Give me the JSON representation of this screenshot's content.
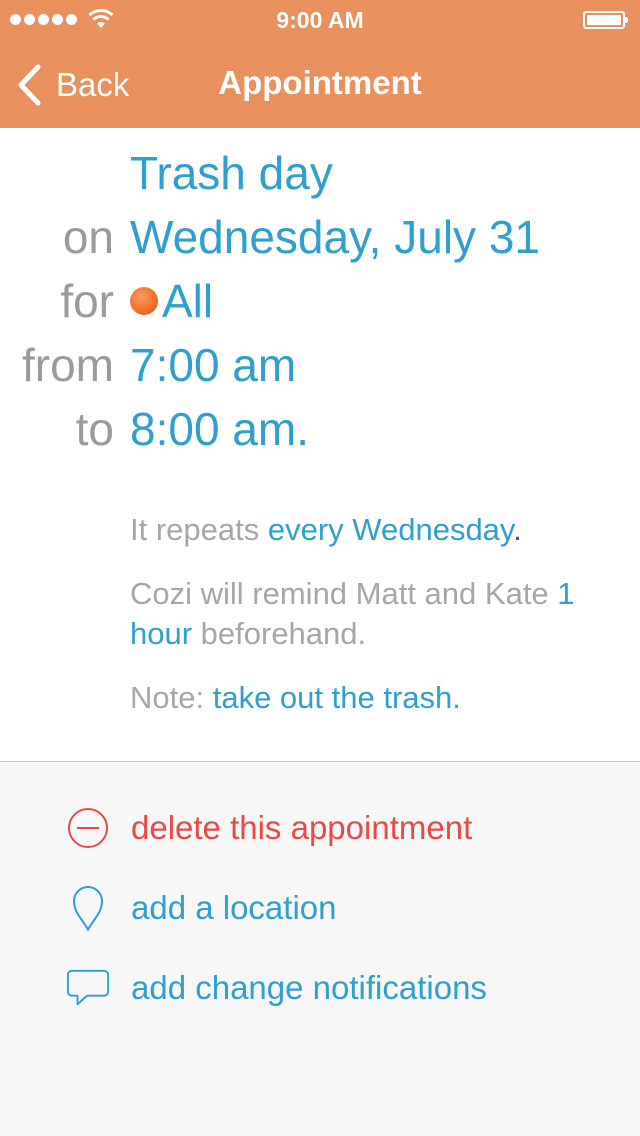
{
  "status_bar": {
    "time": "9:00 AM"
  },
  "nav": {
    "back_label": "Back",
    "title": "Appointment"
  },
  "appointment": {
    "title": "Trash day",
    "date_prefix": "on",
    "date": "Wednesday, July 31",
    "for_prefix": "for",
    "attendees": "All",
    "attendee_color": "#f26522",
    "from_prefix": "from",
    "start_time": "7:00 am",
    "to_prefix": "to",
    "end_time": "8:00 am."
  },
  "info": {
    "repeat_prefix": "It repeats ",
    "repeat_value": "every Wednesday",
    "repeat_suffix": ".",
    "reminder_prefix": "Cozi will remind Matt and Kate ",
    "reminder_value": "1 hour",
    "reminder_suffix": " beforehand.",
    "note_prefix": "Note: ",
    "note_value": "take out the trash."
  },
  "actions": {
    "delete_label": "delete this appointment",
    "location_label": "add a location",
    "notifications_label": "add change notifications"
  },
  "colors": {
    "header": "#e8915e",
    "link": "#2e9fcf",
    "label": "#9a9a9a",
    "danger": "#e84a48"
  },
  "icons": {
    "back": "chevron-left-icon",
    "delete": "minus-circle-icon",
    "location": "map-pin-icon",
    "notifications": "speech-bubble-icon"
  }
}
